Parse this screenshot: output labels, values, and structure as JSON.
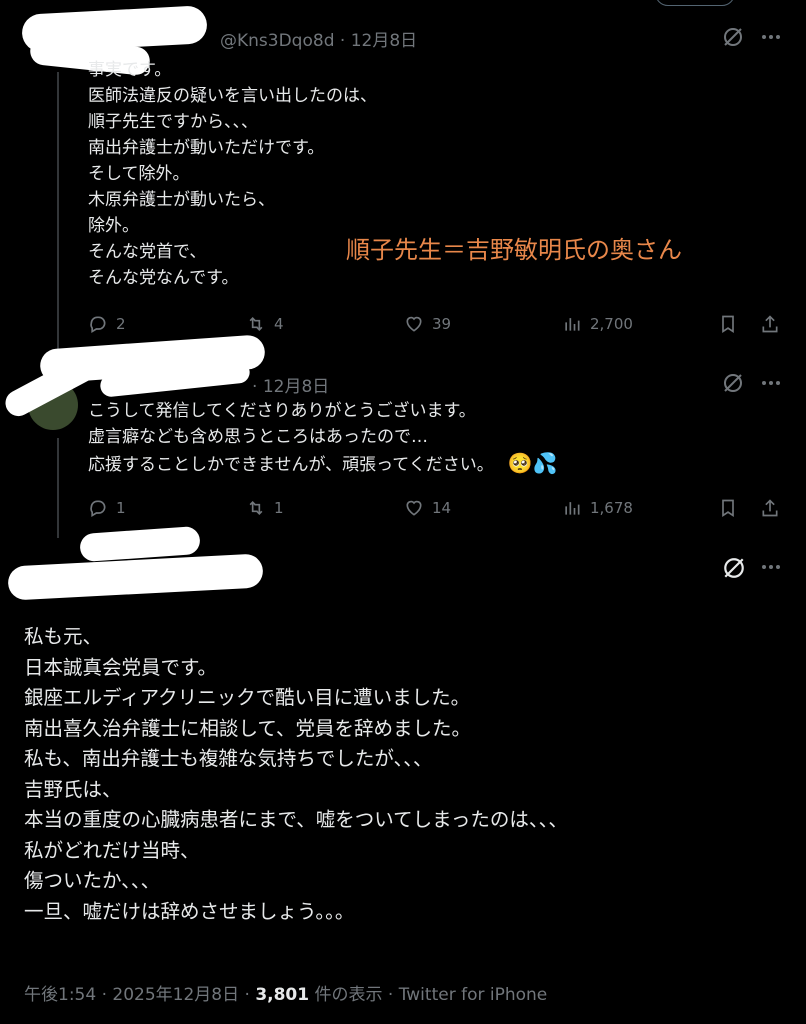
{
  "tweets": [
    {
      "handle": "@Kns3Dqo8d",
      "date": "12月8日",
      "lines": [
        "事実です。",
        "医師法違反の疑いを言い出したのは、",
        "順子先生ですから、、、",
        "南出弁護士が動いただけです。",
        "そして除外。",
        "木原弁護士が動いたら、",
        "除外。",
        "そんな党首で、",
        "そんな党なんです。"
      ],
      "replies": "2",
      "retweets": "4",
      "likes": "39",
      "views": "2,700"
    },
    {
      "handle": "",
      "date": "12月8日",
      "lines": [
        "こうして発信してくださりありがとうございます。",
        "虚言癖なども含め思うところはあったので…",
        "応援することしかできませんが、頑張ってください。"
      ],
      "emoji": "🥺💦",
      "replies": "1",
      "retweets": "1",
      "likes": "14",
      "views": "1,678"
    },
    {
      "handle": "",
      "lines": [
        "私も元、",
        "日本誠真会党員です。",
        "銀座エルディアクリニックで酷い目に遭いました。",
        "南出喜久治弁護士に相談して、党員を辞めました。",
        "私も、南出弁護士も複雑な気持ちでしたが、、、",
        "吉野氏は、",
        "本当の重度の心臓病患者にまで、嘘をついてしまったのは、、、",
        "私がどれだけ当時、",
        "傷ついたか、、、",
        "一旦、嘘だけは辞めさせましょう。。。"
      ],
      "footer": {
        "time": "午後1:54 · 2025年12月8日 · ",
        "views_count": "3,801",
        "views_label": " 件の表示 · Twitter for iPhone"
      }
    }
  ],
  "annotation": "順子先生＝吉野敏明氏の奥さん",
  "colors": {
    "background": "#000000",
    "text": "#e7e9ea",
    "muted": "#71767b",
    "annotation": "#e8874a"
  },
  "icons": {
    "reply": "reply-icon",
    "retweet": "retweet-icon",
    "like": "heart-icon",
    "views": "views-icon",
    "bookmark": "bookmark-icon",
    "share": "share-icon",
    "grok": "grok-icon",
    "more": "more-icon"
  }
}
